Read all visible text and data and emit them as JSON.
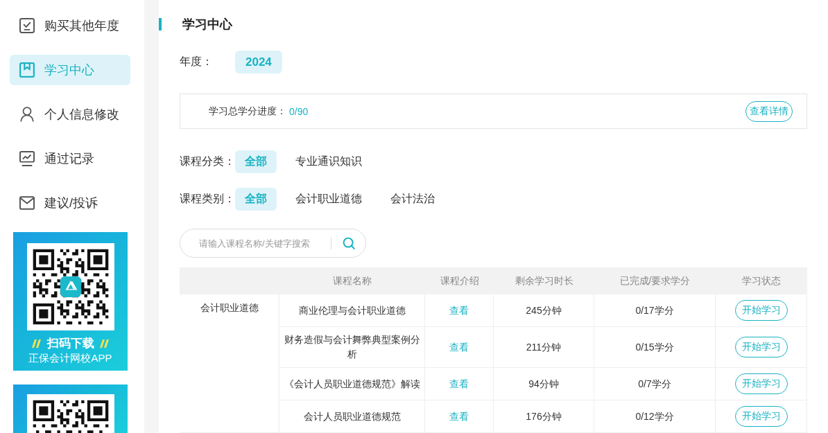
{
  "sidebar": {
    "items": [
      {
        "label": "购买其他年度",
        "selected": false
      },
      {
        "label": "学习中心",
        "selected": true
      },
      {
        "label": "个人信息修改",
        "selected": false
      },
      {
        "label": "通过记录",
        "selected": false
      },
      {
        "label": "建议/投诉",
        "selected": false
      }
    ],
    "banners": [
      {
        "clipped": false,
        "title": "扫码下载",
        "subtitle": "正保会计网校APP"
      },
      {
        "clipped": true
      }
    ]
  },
  "page_title": "学习中心",
  "year": {
    "label": "年度：",
    "options": [
      {
        "label": "2024",
        "selected": true
      }
    ]
  },
  "progress": {
    "label": "学习总学分进度：",
    "value": "0/90",
    "button": "查看详情"
  },
  "filters": [
    {
      "label": "课程分类：",
      "options": [
        {
          "label": "全部",
          "selected": true
        },
        {
          "label": "专业通识知识",
          "selected": false
        }
      ]
    },
    {
      "label": "课程类别：",
      "options": [
        {
          "label": "全部",
          "selected": true
        },
        {
          "label": "会计职业道德",
          "selected": false
        },
        {
          "label": "会计法治",
          "selected": false
        }
      ]
    }
  ],
  "search": {
    "placeholder": "请输入课程名称/关键字搜索"
  },
  "table": {
    "columns": [
      "课程名称",
      "课程介绍",
      "剩余学习时长",
      "已完成/要求学分",
      "学习状态"
    ],
    "groups": [
      {
        "category": "会计职业道德",
        "rows": [
          {
            "name": "商业伦理与会计职业道德",
            "intro": "查看",
            "remaining": "245分钟",
            "credits": "0/17学分",
            "action": "开始学习"
          },
          {
            "name": "财务造假与会计舞弊典型案例分析",
            "intro": "查看",
            "remaining": "211分钟",
            "credits": "0/15学分",
            "action": "开始学习"
          },
          {
            "name": "《会计人员职业道德规范》解读",
            "intro": "查看",
            "remaining": "94分钟",
            "credits": "0/7学分",
            "action": "开始学习"
          },
          {
            "name": "会计人员职业道德规范",
            "intro": "查看",
            "remaining": "176分钟",
            "credits": "0/12学分",
            "action": "开始学习"
          }
        ]
      }
    ]
  }
}
